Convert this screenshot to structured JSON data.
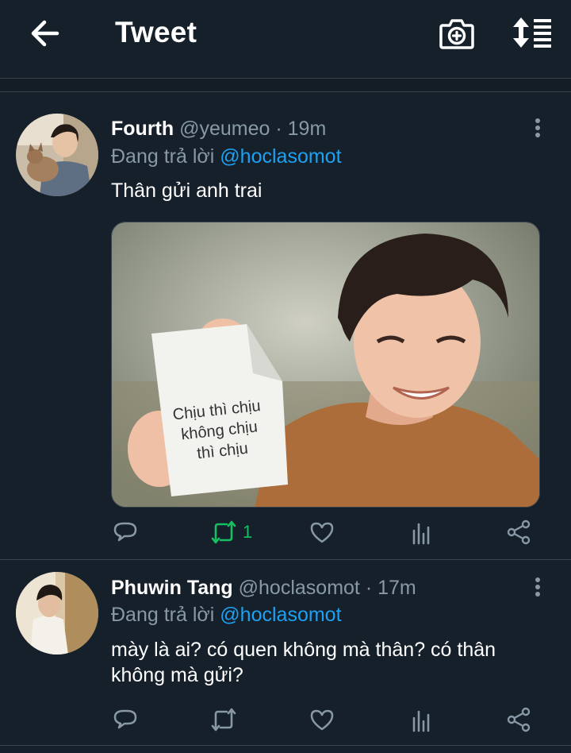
{
  "header": {
    "title": "Tweet",
    "back_icon": "arrow-left-icon",
    "camera_icon": "camera-plus-icon",
    "sort_icon": "sort-icon"
  },
  "tweets": [
    {
      "name": "Fourth",
      "handle": "@yeumeo",
      "time": "· 19m",
      "reply_prefix": "Đang trả lời",
      "reply_to": "@hoclasomot",
      "text": "Thân gửi anh trai",
      "media_caption": "Chịu thì chịu không chịu thì chịu",
      "retweet_count": "1",
      "retweeted": true
    },
    {
      "name": "Phuwin Tang",
      "handle": "@hoclasomot",
      "time": "· 17m",
      "reply_prefix": "Đang trả lời",
      "reply_to": "@hoclasomot",
      "text": "mày là ai? có quen không mà thân? có thân không mà gửi?",
      "retweet_count": "",
      "retweeted": false
    }
  ],
  "colors": {
    "background": "#15202b",
    "accent": "#1da1f2",
    "muted": "#8899a6",
    "retweet_active": "#17bf63"
  }
}
